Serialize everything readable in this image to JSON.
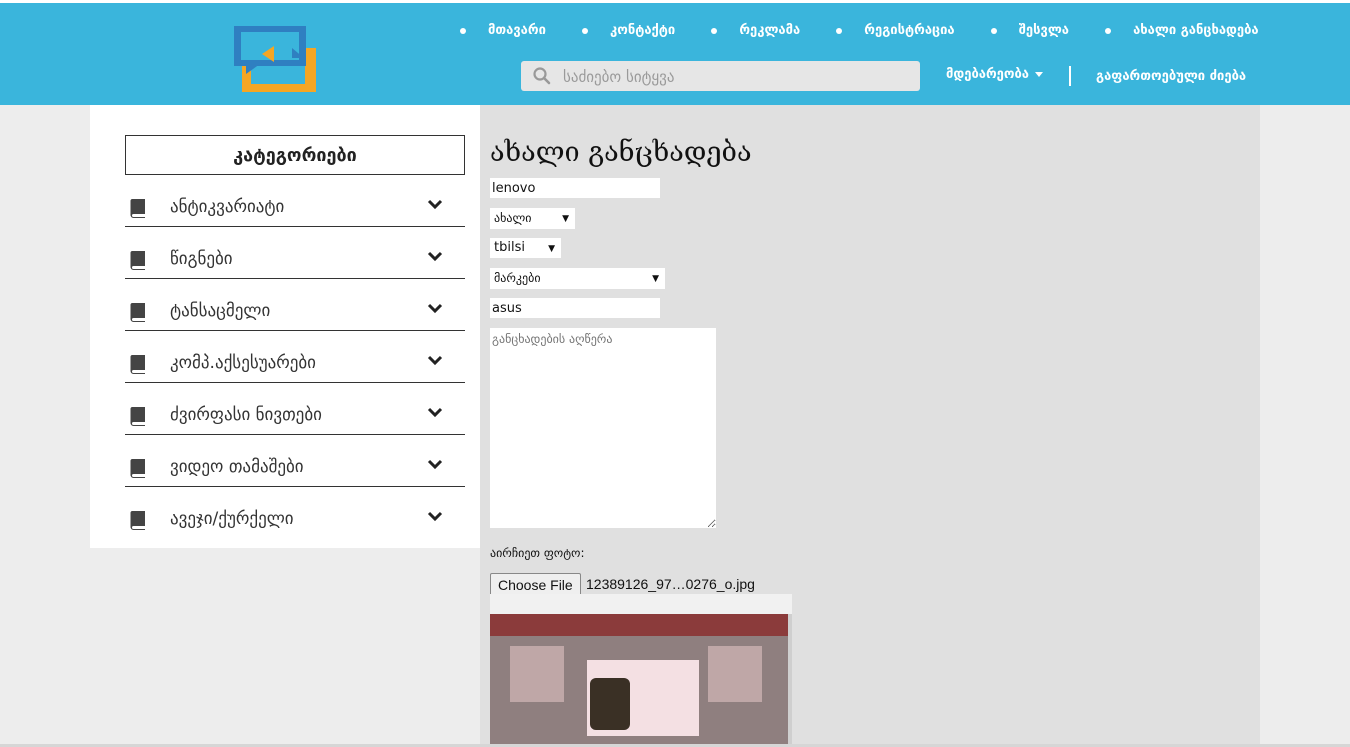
{
  "header": {
    "nav": [
      "მთავარი",
      "კონტაქტი",
      "რეკლამა",
      "რეგისტრაცია",
      "შესვლა",
      "ახალი განცხადება"
    ],
    "search_placeholder": "საძიებო სიტყვა",
    "location_label": "მდებარეობა",
    "advanced_search": "გაფართოებული ძიება"
  },
  "colors": {
    "header_bg": "#3ab5dc",
    "logo_blue": "#2f7fc1",
    "logo_orange": "#f5a623"
  },
  "sidebar": {
    "title": "კატეგორიები",
    "items": [
      {
        "label": "ანტიკვარიატი",
        "icon": "book-icon"
      },
      {
        "label": "წიგნები",
        "icon": "book-icon"
      },
      {
        "label": "ტანსაცმელი",
        "icon": "book-icon"
      },
      {
        "label": "კომპ.აქსესუარები",
        "icon": "book-icon"
      },
      {
        "label": "ძვირფასი ნივთები",
        "icon": "book-icon"
      },
      {
        "label": "ვიდეო თამაშები",
        "icon": "book-icon"
      },
      {
        "label": "ავეჯი/ქურქელი",
        "icon": "book-icon"
      }
    ]
  },
  "form": {
    "title": "ახალი განცხადება",
    "name_value": "lenovo",
    "condition_value": "ახალი",
    "city_value": "tbilsi",
    "category_value": "მარკები",
    "brand_value": "asus",
    "description_placeholder": "განცხადების აღწერა",
    "photo_label": "აირჩიეთ ფოტო:",
    "choose_file": "Choose File",
    "file_name": "12389126_97…0276_o.jpg"
  }
}
